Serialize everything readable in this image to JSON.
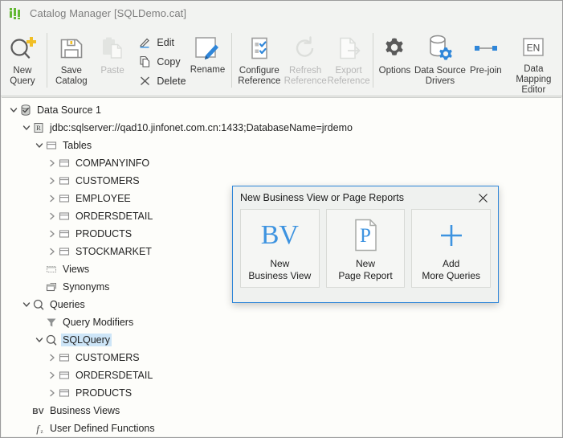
{
  "window": {
    "title": "Catalog Manager [SQLDemo.cat]",
    "icon": "bar-chart-icon"
  },
  "toolbar": {
    "items": [
      {
        "id": "new-query",
        "label": "New\nQuery",
        "icon": "query-plus-icon",
        "disabled": false
      },
      {
        "id": "save-catalog",
        "label": "Save\nCatalog",
        "icon": "floppy-disk-icon",
        "disabled": false
      },
      {
        "id": "paste",
        "label": "Paste",
        "icon": "clipboard-icon",
        "disabled": true
      },
      {
        "id": "rename",
        "label": "Rename",
        "icon": "pencil-page-icon",
        "disabled": false
      },
      {
        "id": "configure-reference",
        "label": "Configure\nReference",
        "icon": "checklist-icon",
        "disabled": false
      },
      {
        "id": "refresh-reference",
        "label": "Refresh\nReference",
        "icon": "refresh-icon",
        "disabled": true
      },
      {
        "id": "export-reference",
        "label": "Export\nReference",
        "icon": "export-page-icon",
        "disabled": true
      },
      {
        "id": "options",
        "label": "Options",
        "icon": "gear-icon",
        "disabled": false
      },
      {
        "id": "data-source-drivers",
        "label": "Data Source\nDrivers",
        "icon": "database-gear-icon",
        "disabled": false
      },
      {
        "id": "pre-join",
        "label": "Pre-join",
        "icon": "link-nodes-icon",
        "disabled": false
      },
      {
        "id": "data-mapping-editor",
        "label": "Data Mapping\nEditor",
        "icon": "en-badge-icon",
        "disabled": false
      }
    ],
    "commands": [
      {
        "id": "edit",
        "label": "Edit",
        "icon": "pencil-icon"
      },
      {
        "id": "copy",
        "label": "Copy",
        "icon": "copy-icon"
      },
      {
        "id": "delete",
        "label": "Delete",
        "icon": "x-icon"
      }
    ],
    "en_badge": "EN"
  },
  "tree": {
    "nodes": [
      {
        "id": "data-source-1",
        "label": "Data Source 1",
        "indent": 0,
        "twist": "expanded",
        "icon": "database-check-icon",
        "selected": false
      },
      {
        "id": "jdbc-url",
        "label": "jdbc:sqlserver://qad10.jinfonet.com.cn:1433;DatabaseName=jrdemo",
        "indent": 1,
        "twist": "expanded",
        "icon": "connection-icon",
        "selected": false
      },
      {
        "id": "tables",
        "label": "Tables",
        "indent": 2,
        "twist": "expanded",
        "icon": "folder-table-icon",
        "selected": false
      },
      {
        "id": "companyinfo",
        "label": "COMPANYINFO",
        "indent": 3,
        "twist": "collapsed",
        "icon": "table-icon",
        "selected": false
      },
      {
        "id": "customers",
        "label": "CUSTOMERS",
        "indent": 3,
        "twist": "collapsed",
        "icon": "table-icon",
        "selected": false
      },
      {
        "id": "employee",
        "label": "EMPLOYEE",
        "indent": 3,
        "twist": "collapsed",
        "icon": "table-icon",
        "selected": false
      },
      {
        "id": "ordersdetail",
        "label": "ORDERSDETAIL",
        "indent": 3,
        "twist": "collapsed",
        "icon": "table-icon",
        "selected": false
      },
      {
        "id": "products",
        "label": "PRODUCTS",
        "indent": 3,
        "twist": "collapsed",
        "icon": "table-icon",
        "selected": false
      },
      {
        "id": "stockmarket",
        "label": "STOCKMARKET",
        "indent": 3,
        "twist": "collapsed",
        "icon": "table-icon",
        "selected": false
      },
      {
        "id": "views",
        "label": "Views",
        "indent": 2,
        "twist": "none",
        "icon": "views-icon",
        "selected": false
      },
      {
        "id": "synonyms",
        "label": "Synonyms",
        "indent": 2,
        "twist": "none",
        "icon": "synonyms-icon",
        "selected": false
      },
      {
        "id": "queries",
        "label": "Queries",
        "indent": 1,
        "twist": "expanded",
        "icon": "query-icon",
        "selected": false
      },
      {
        "id": "query-modifiers",
        "label": "Query Modifiers",
        "indent": 2,
        "twist": "none",
        "icon": "funnel-icon",
        "selected": false
      },
      {
        "id": "sqlquery",
        "label": "SQLQuery",
        "indent": 2,
        "twist": "expanded",
        "icon": "query-icon",
        "selected": true
      },
      {
        "id": "q-customers",
        "label": "CUSTOMERS",
        "indent": 3,
        "twist": "collapsed",
        "icon": "table-icon",
        "selected": false
      },
      {
        "id": "q-ordersdetail",
        "label": "ORDERSDETAIL",
        "indent": 3,
        "twist": "collapsed",
        "icon": "table-icon",
        "selected": false
      },
      {
        "id": "q-products",
        "label": "PRODUCTS",
        "indent": 3,
        "twist": "collapsed",
        "icon": "table-icon",
        "selected": false
      },
      {
        "id": "business-views",
        "label": "Business Views",
        "indent": 1,
        "twist": "none",
        "icon": "bv-icon",
        "selected": false
      },
      {
        "id": "udf",
        "label": "User Defined Functions",
        "indent": 1,
        "twist": "none",
        "icon": "function-icon",
        "selected": false
      }
    ]
  },
  "dialog": {
    "title": "New Business View or Page Reports",
    "close_icon": "close-icon",
    "tiles": [
      {
        "id": "new-business-view",
        "label": "New\nBusiness View",
        "icon": "bv-glyph-icon"
      },
      {
        "id": "new-page-report",
        "label": "New\nPage Report",
        "icon": "page-report-icon"
      },
      {
        "id": "add-more-queries",
        "label": "Add\nMore Queries",
        "icon": "plus-icon"
      }
    ]
  },
  "colors": {
    "accent_blue": "#3d93e0",
    "dialog_border": "#2d85d8",
    "selection": "#cde5f7",
    "title_green": "#63b832",
    "ribbon_bg": "#f2f3f1",
    "tree_bg": "#fdfdfa",
    "disabled_text": "#b7b7b7"
  }
}
